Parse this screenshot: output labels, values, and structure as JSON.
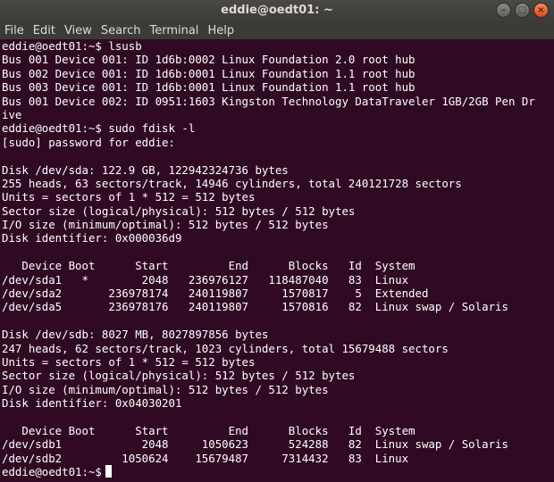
{
  "window": {
    "title": "eddie@oedt01: ~",
    "buttons": [
      "close",
      "minimize",
      "maximize"
    ]
  },
  "menu": [
    "File",
    "Edit",
    "View",
    "Search",
    "Terminal",
    "Help"
  ],
  "terminal": {
    "lines": [
      "eddie@oedt01:~$ lsusb",
      "Bus 001 Device 001: ID 1d6b:0002 Linux Foundation 2.0 root hub",
      "Bus 002 Device 001: ID 1d6b:0001 Linux Foundation 1.1 root hub",
      "Bus 003 Device 001: ID 1d6b:0001 Linux Foundation 1.1 root hub",
      "Bus 001 Device 002: ID 0951:1603 Kingston Technology DataTraveler 1GB/2GB Pen Dr",
      "ive",
      "eddie@oedt01:~$ sudo fdisk -l",
      "[sudo] password for eddie:",
      "",
      "Disk /dev/sda: 122.9 GB, 122942324736 bytes",
      "255 heads, 63 sectors/track, 14946 cylinders, total 240121728 sectors",
      "Units = sectors of 1 * 512 = 512 bytes",
      "Sector size (logical/physical): 512 bytes / 512 bytes",
      "I/O size (minimum/optimal): 512 bytes / 512 bytes",
      "Disk identifier: 0x000036d9",
      "",
      "   Device Boot      Start         End      Blocks   Id  System",
      "/dev/sda1   *        2048   236976127   118487040   83  Linux",
      "/dev/sda2       236978174   240119807     1570817    5  Extended",
      "/dev/sda5       236978176   240119807     1570816   82  Linux swap / Solaris",
      "",
      "Disk /dev/sdb: 8027 MB, 8027897856 bytes",
      "247 heads, 62 sectors/track, 1023 cylinders, total 15679488 sectors",
      "Units = sectors of 1 * 512 = 512 bytes",
      "Sector size (logical/physical): 512 bytes / 512 bytes",
      "I/O size (minimum/optimal): 512 bytes / 512 bytes",
      "Disk identifier: 0x04030201",
      "",
      "   Device Boot      Start         End      Blocks   Id  System",
      "/dev/sdb1            2048     1050623      524288   82  Linux swap / Solaris",
      "/dev/sdb2         1050624    15679487     7314432   83  Linux"
    ],
    "prompt": "eddie@oedt01:~$"
  },
  "colors": {
    "terminal_bg": "#300a24",
    "terminal_fg": "#ffffff",
    "titlebar_bg": "#3c3b37",
    "close_button": "#df4a16"
  }
}
